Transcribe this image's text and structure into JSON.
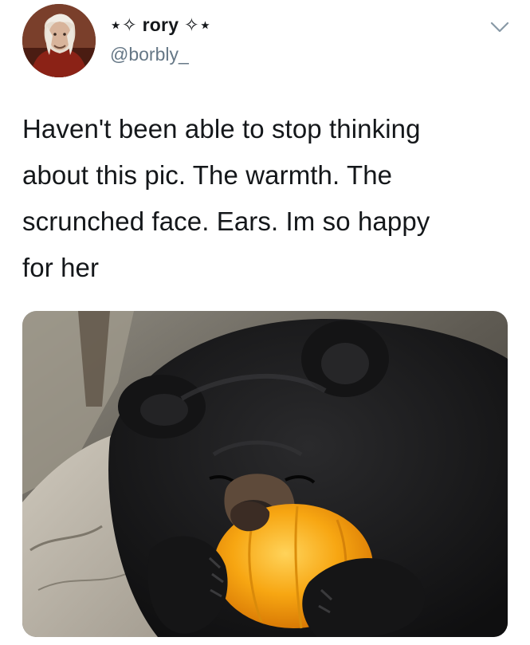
{
  "tweet": {
    "author": {
      "display_name": "⋆✧ rory ✧⋆",
      "handle": "@borbly_",
      "avatar_icon": "avatar-photo"
    },
    "menu_icon": "chevron-down-icon",
    "text_lines": [
      "Haven't been able to stop thinking",
      "about this pic. The warmth. The",
      "scrunched face. Ears. Im so happy",
      "for her"
    ],
    "media": {
      "kind": "photo",
      "subject_icon": "bear-hugging-pumpkin-photo"
    }
  },
  "colors": {
    "text": "#14171a",
    "secondary_text": "#657786",
    "chevron": "#8899a6",
    "pumpkin": "#f5a00f",
    "fur": "#1b1b1d"
  }
}
